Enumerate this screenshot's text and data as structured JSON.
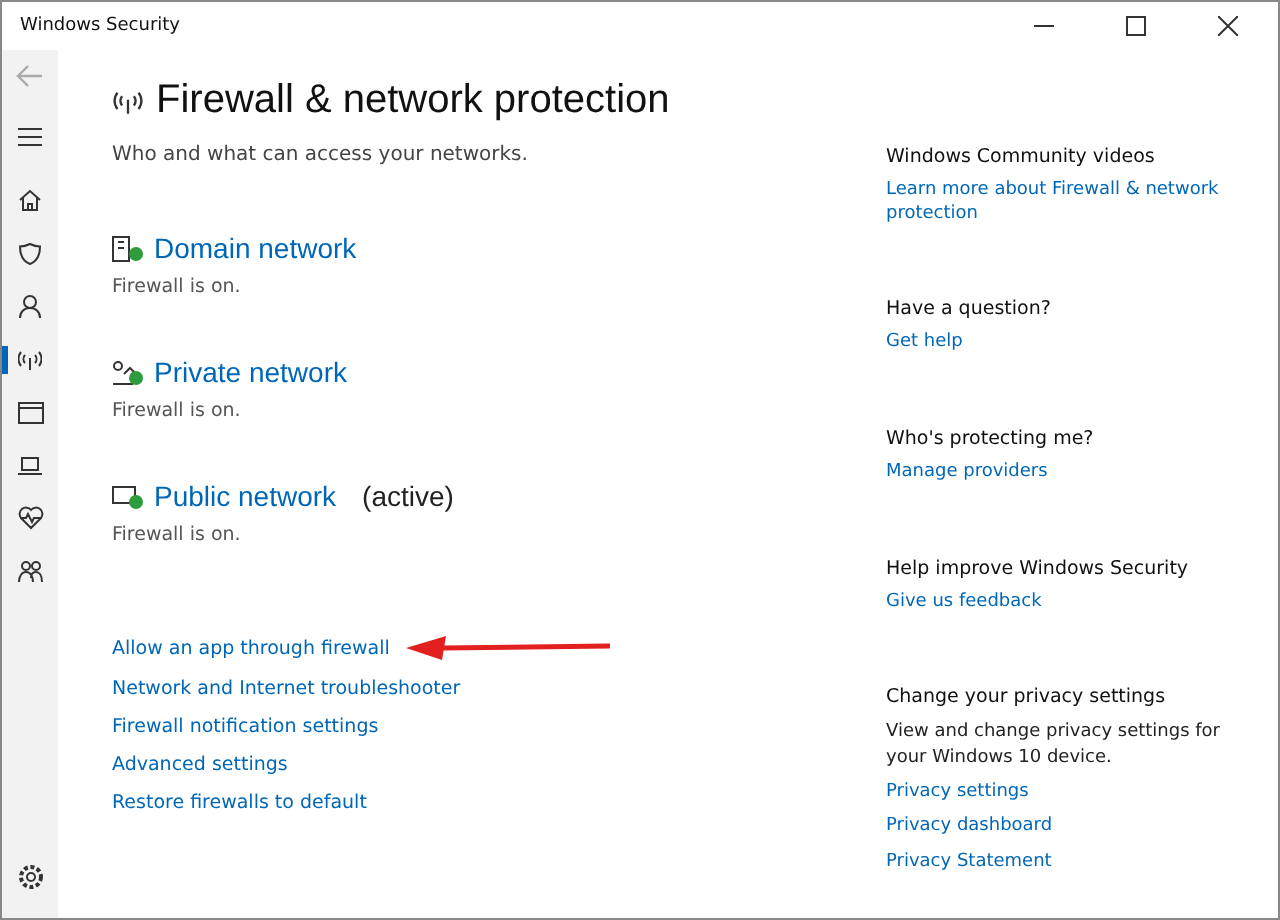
{
  "window": {
    "title": "Windows Security"
  },
  "nav": [
    {
      "kind": "home",
      "selected": false
    },
    {
      "kind": "shield",
      "selected": false
    },
    {
      "kind": "person",
      "selected": false
    },
    {
      "kind": "antenna",
      "selected": true
    },
    {
      "kind": "browser",
      "selected": false
    },
    {
      "kind": "laptop",
      "selected": false
    },
    {
      "kind": "heart",
      "selected": false
    },
    {
      "kind": "family",
      "selected": false
    }
  ],
  "page": {
    "title": "Firewall & network protection",
    "subtitle": "Who and what can access your networks."
  },
  "networks": [
    {
      "kind": "domain",
      "name": "Domain network",
      "status": "Firewall is on."
    },
    {
      "kind": "private",
      "name": "Private network",
      "status": "Firewall is on."
    },
    {
      "kind": "public",
      "name": "Public network",
      "badge": "(active)",
      "status": "Firewall is on."
    }
  ],
  "links": [
    "Allow an app through firewall",
    "Network and Internet troubleshooter",
    "Firewall notification settings",
    "Advanced settings",
    "Restore firewalls to default"
  ],
  "side_sections": [
    {
      "heading": "Windows Community videos",
      "links": [
        "Learn more about Firewall & network protection"
      ]
    },
    {
      "heading": "Have a question?",
      "links": [
        "Get help"
      ]
    },
    {
      "heading": "Who's protecting me?",
      "links": [
        "Manage providers"
      ]
    },
    {
      "heading": "Help improve Windows Security",
      "links": [
        "Give us feedback"
      ]
    },
    {
      "heading": "Change your privacy settings",
      "text": "View and change privacy settings for your Windows 10 device.",
      "links": [
        "Privacy settings",
        "Privacy dashboard",
        "Privacy Statement"
      ]
    }
  ]
}
